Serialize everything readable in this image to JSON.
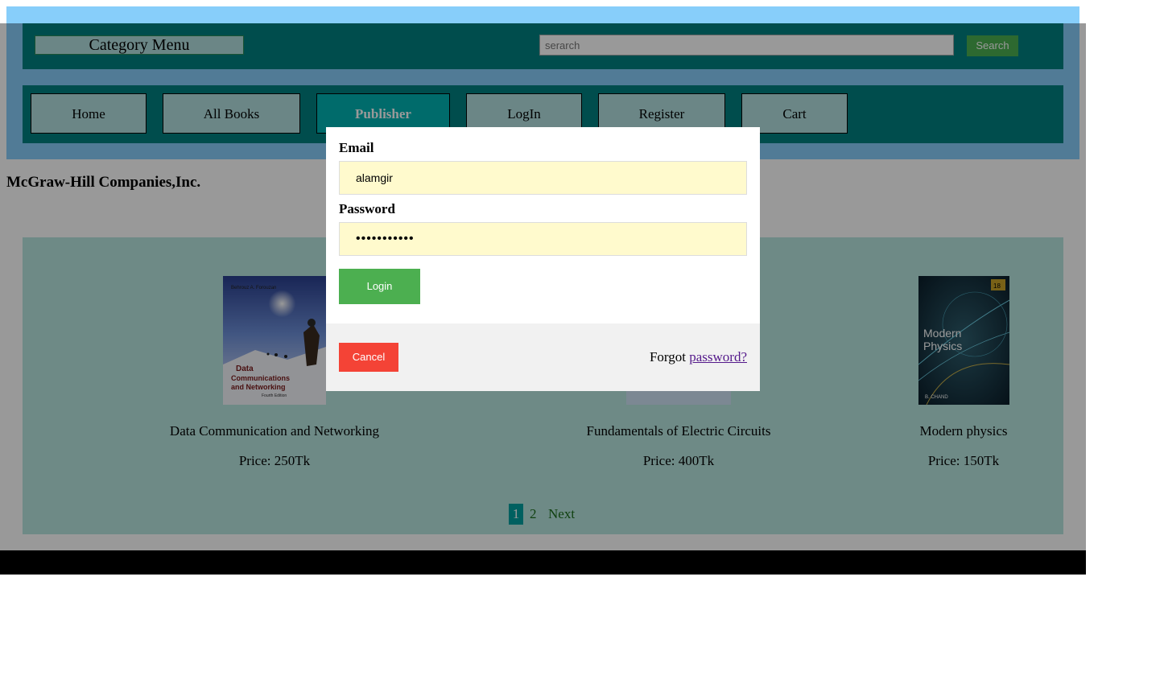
{
  "header": {
    "category_menu": "Category Menu",
    "search_placeholder": "serarch",
    "search_button": "Search"
  },
  "nav": {
    "items": [
      {
        "label": "Home"
      },
      {
        "label": "All Books"
      },
      {
        "label": "Publisher"
      },
      {
        "label": "LogIn"
      },
      {
        "label": "Register"
      },
      {
        "label": "Cart"
      }
    ],
    "active": "Publisher"
  },
  "publisher_name": "McGraw-Hill Companies,Inc.",
  "books": [
    {
      "title": "Data Communication and Networking",
      "price": "Price: 250Tk",
      "cover_text": "Data Communications and Networking",
      "cover_author": "Behrouz A. Forouzan"
    },
    {
      "title": "Fundamentals of Electric Circuits",
      "price": "Price: 400Tk"
    },
    {
      "title": "Modern physics",
      "price": "Price: 150Tk",
      "cover_text": "Modern Physics",
      "cover_author": "B. CHAND"
    }
  ],
  "pagination": {
    "pages": [
      "1",
      "2"
    ],
    "current": "1",
    "next": "Next"
  },
  "login_modal": {
    "email_label": "Email",
    "email_value": "alamgir",
    "password_label": "Password",
    "password_value": "•••••••••••",
    "login_button": "Login",
    "cancel_button": "Cancel",
    "forgot_prefix": "Forgot",
    "forgot_link": "password?"
  },
  "colors": {
    "header_band": "#87cefa",
    "bar_teal": "#008080",
    "login_green": "#4caf50",
    "cancel_red": "#f44336",
    "input_yellow": "#fffacd"
  }
}
